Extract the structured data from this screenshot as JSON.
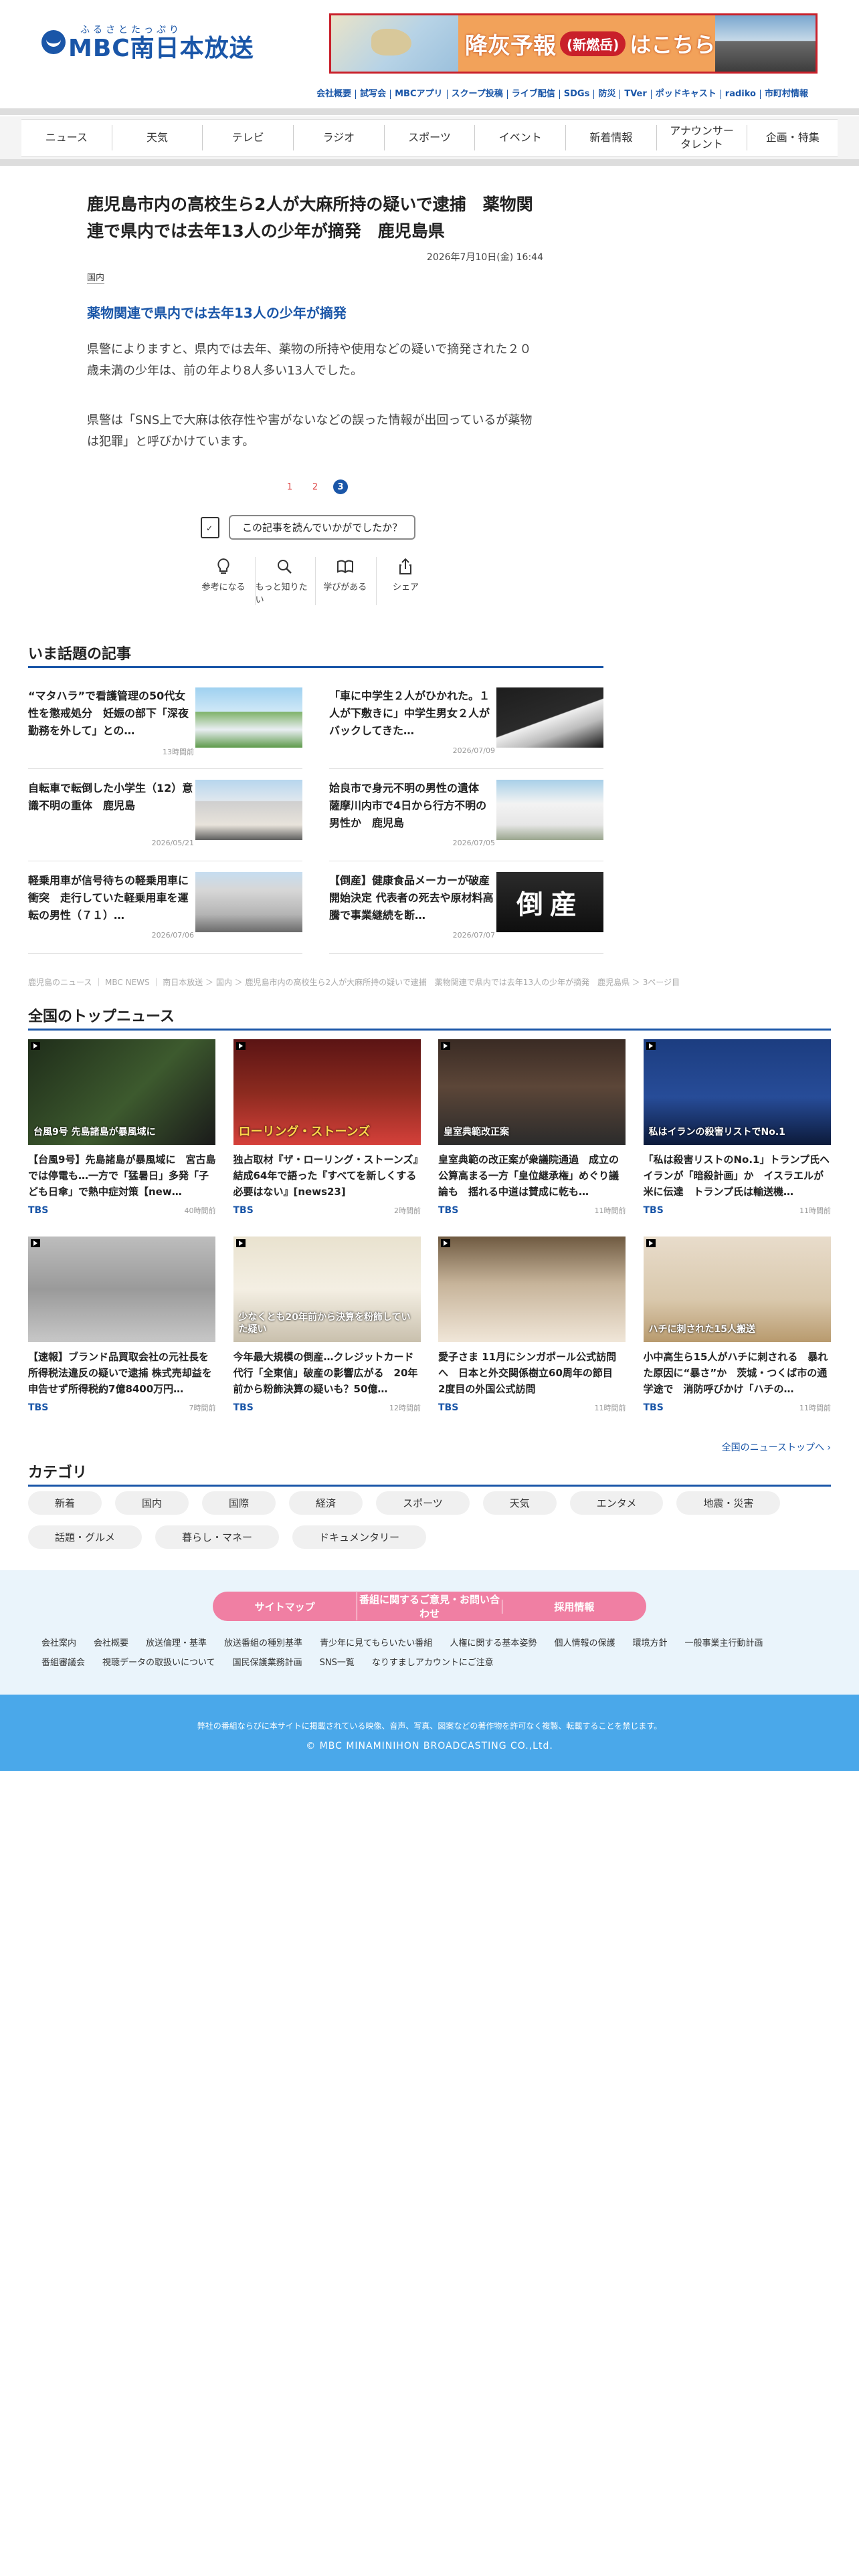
{
  "header": {
    "logo_kana": "ふるさとたっぷり",
    "logo_name": "MBC南日本放送",
    "banner_main": "降灰予報",
    "banner_pill": "(新燃岳)",
    "banner_tail": "はこちら"
  },
  "top_links": [
    "会社概要",
    "試写会",
    "MBCアプリ",
    "スクープ投稿",
    "ライブ配信",
    "SDGs",
    "防災",
    "TVer",
    "ポッドキャスト",
    "radiko",
    "市町村情報"
  ],
  "nav": [
    "ニュース",
    "天気",
    "テレビ",
    "ラジオ",
    "スポーツ",
    "イベント",
    "新着情報",
    "アナウンサー\nタレント",
    "企画・特集"
  ],
  "article": {
    "headline": "鹿児島市内の高校生ら2人が大麻所持の疑いで逮捕　薬物関連で県内では去年13人の少年が摘発　鹿児島県",
    "date": "2026年7月10日(金) 16:44",
    "category": "国内",
    "subhead": "薬物関連で県内では去年13人の少年が摘発",
    "para1": "県警によりますと、県内では去年、薬物の所持や使用などの疑いで摘発された２０歳未満の少年は、前の年より8人多い13人でした。",
    "para2": "県警は「SNS上で大麻は依存性や害がないなどの誤った情報が出回っているが薬物は犯罪」と呼びかけています。",
    "pages": [
      "1",
      "2",
      "3"
    ],
    "current_page": "3"
  },
  "reaction": {
    "question": "この記事を読んでいかがでしたか？",
    "options": [
      "参考になる",
      "もっと知りたい",
      "学びがある",
      "シェア"
    ]
  },
  "popular": {
    "title": "いま話題の記事",
    "items": [
      {
        "title": "“マタハラ”で看護管理の50代女性を懲戒処分　妊娠の部下「深夜勤務を外して」との…",
        "date": "13時間前"
      },
      {
        "title": "「車に中学生２人がひかれた。１人が下敷きに」中学生男女２人がバックしてきた…",
        "date": "2026/07/09"
      },
      {
        "title": "自転車で転倒した小学生（12）意識不明の重体　鹿児島",
        "date": "2026/05/21"
      },
      {
        "title": "姶良市で身元不明の男性の遺体　薩摩川内市で4日から行方不明の男性か　鹿児島",
        "date": "2026/07/05"
      },
      {
        "title": "軽乗用車が信号待ちの軽乗用車に衝突　走行していた軽乗用車を運転の男性（７１）…",
        "date": "2026/07/06"
      },
      {
        "title": "【倒産】健康食品メーカーが破産開始決定 代表者の死去や原材料高騰で事業継続を断…",
        "date": "2026/07/07"
      }
    ],
    "stamp_text": "倒産"
  },
  "breadcrumb": "鹿児島のニュース ｜ MBC NEWS ｜ 南日本放送 ＞ 国内 ＞ 鹿児島市内の高校生ら2人が大麻所持の疑いで逮捕　薬物関連で県内では去年13人の少年が摘発　鹿児島県 ＞ 3ページ目",
  "top_news": {
    "title": "全国のトップニュース",
    "items": [
      {
        "title": "【台風9号】先島諸島が暴風域に　宮古島では停電も…一方で「猛暑日」多発「子ども日傘」で熱中症対策【new…",
        "source": "TBS",
        "time": "40時間前"
      },
      {
        "title": "独占取材『ザ・ローリング・ストーンズ』結成64年で語った『すべてを新しくする必要はない』[news23]",
        "source": "TBS",
        "time": "2時間前"
      },
      {
        "title": "皇室典範の改正案が衆議院通過　成立の公算高まる一方「皇位継承権」めぐり議論も　揺れる中道は賛成に乾も…",
        "source": "TBS",
        "time": "11時間前"
      },
      {
        "title": "「私は殺害リストのNo.1」トランプ氏ヘイランが「暗殺計画」か　イスラエルが米に伝達　トランプ氏は輸送機…",
        "source": "TBS",
        "time": "11時間前"
      },
      {
        "title": "【速報】ブランド品買取会社の元社長を所得税法違反の疑いで逮捕 株式売却益を申告せず所得税約7億8400万円…",
        "source": "TBS",
        "time": "7時間前"
      },
      {
        "title": "今年最大規模の倒産…クレジットカード代行「全東信」破産の影響広がる　20年前から粉飾決算の疑いも？50億…",
        "source": "TBS",
        "time": "12時間前"
      },
      {
        "title": "愛子さま 11月にシンガポール公式訪問へ　日本と外交関係樹立60周年の節目　2度目の外国公式訪問",
        "source": "TBS",
        "time": "11時間前"
      },
      {
        "title": "小中高生ら15人がハチに刺される　暴れた原因に“暴さ”か　茨城・つくば市の通学途で　消防呼びかけ「ハチの…",
        "source": "TBS",
        "time": "11時間前"
      }
    ],
    "img_captions": [
      "台風9号 先島諸島が暴風域に",
      "ローリング・ストーンズ",
      "皇室典範改正案",
      "私はイランの殺害リストでNo.1",
      "",
      "少なくとも20年前から決算を粉飾していた疑い",
      "",
      "ハチに刺された15人搬送"
    ],
    "more": "全国のニューストップへ ›"
  },
  "categories": {
    "title": "カテゴリ",
    "items": [
      "新着",
      "国内",
      "国際",
      "経済",
      "スポーツ",
      "天気",
      "エンタメ",
      "地震・災害",
      "話題・グルメ",
      "暮らし・マネー",
      "ドキュメンタリー"
    ]
  },
  "footer": {
    "pink": [
      "サイトマップ",
      "番組に関するご意見・お問い合わせ",
      "採用情報"
    ],
    "links": [
      "会社案内",
      "会社概要",
      "放送倫理・基準",
      "放送番組の種別基準",
      "青少年に見てもらいたい番組",
      "人権に関する基本姿勢",
      "個人情報の保護",
      "環境方針",
      "一般事業主行動計画",
      "番組審議会",
      "視聴データの取扱いについて",
      "国民保護業務計画",
      "SNS一覧",
      "なりすましアカウントにご注意"
    ],
    "notice": "弊社の番組ならびに本サイトに掲載されている映像、音声、写真、図案などの著作物を許可なく複製、転載することを禁じます。",
    "copyright": "© MBC MINAMINIHON BROADCASTING CO.,Ltd."
  },
  "colors": {
    "brand": "#1a56a8",
    "pink": "#f07fa3",
    "footer_blue": "#4aa8ea"
  }
}
